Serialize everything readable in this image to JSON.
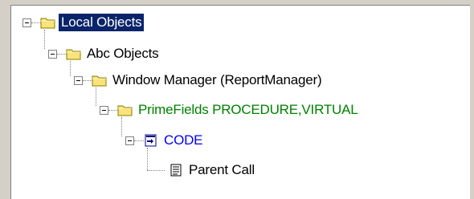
{
  "tree": {
    "nodes": [
      {
        "label": "Local Objects",
        "icon": "folder-icon",
        "selected": true,
        "color": "#ffffff"
      },
      {
        "label": "Abc Objects",
        "icon": "folder-icon",
        "color": "#000000"
      },
      {
        "label": "Window Manager (ReportManager)",
        "icon": "folder-icon",
        "color": "#000000"
      },
      {
        "label": "PrimeFields PROCEDURE,VIRTUAL",
        "icon": "folder-icon",
        "color": "#008000"
      },
      {
        "label": "CODE",
        "icon": "code-embed-icon",
        "color": "#0000ff"
      },
      {
        "label": "Parent Call",
        "icon": "document-icon",
        "color": "#000000"
      }
    ]
  },
  "colors": {
    "selection": "#0a246a",
    "background": "#ffffff",
    "window": "#d4d0c8"
  }
}
